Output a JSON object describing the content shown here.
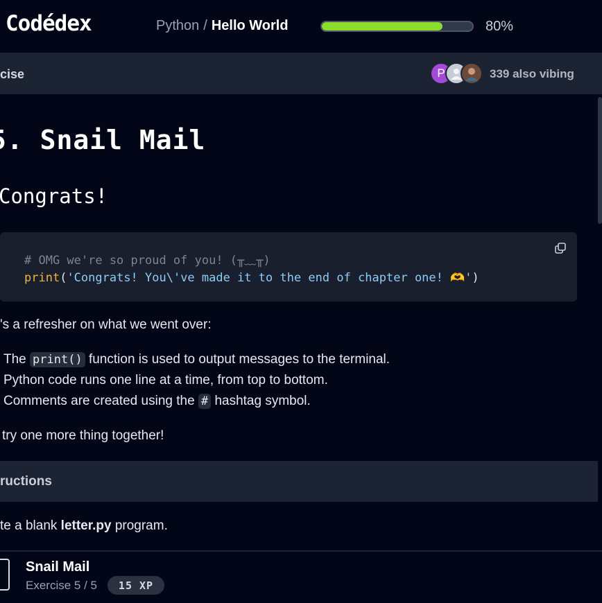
{
  "header": {
    "logo": "Codédex",
    "breadcrumb_course": "Python",
    "breadcrumb_sep": "/",
    "breadcrumb_chapter": "Hello World",
    "progress_percent": 80,
    "progress_label": "80%"
  },
  "subbar": {
    "tab_label": "cise",
    "avatar_initial": "P",
    "vibing": "339 also vibing"
  },
  "content": {
    "title": "5. Snail Mail",
    "subtitle": "Congrats!",
    "code_comment": "# OMG we're so proud of you! (╥﹏╥)",
    "code_fn": "print",
    "code_open": "(",
    "code_string": "'Congrats! You\\'ve made it to the end of chapter one! 🫶'",
    "code_close": ")",
    "refresher": "'s a refresher on what we went over:",
    "bullets": {
      "b1_pre": "The ",
      "b1_code": "print()",
      "b1_post": " function is used to output messages to the terminal.",
      "b2": "Python code runs one line at a time, from top to bottom.",
      "b3_pre": "Comments are created using the ",
      "b3_code": "#",
      "b3_post": " hashtag symbol."
    },
    "closing": "try one more thing together!",
    "instructions_label": "ructions",
    "task_pre": "te a blank ",
    "task_file": "letter.py",
    "task_post": " program."
  },
  "footer": {
    "title": "Snail Mail",
    "exercise": "Exercise 5 / 5",
    "xp": "15 XP"
  },
  "colors": {
    "background": "#030617",
    "progress_fill": "#8bdc2d",
    "panel": "#1c2434",
    "code_bg": "#1a1f2d"
  }
}
